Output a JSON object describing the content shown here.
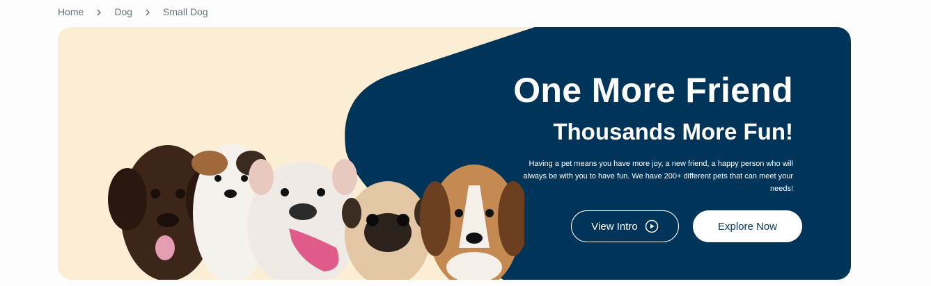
{
  "breadcrumb": {
    "items": [
      "Home",
      "Dog",
      "Small Dog"
    ],
    "separator_icon": "chevron-right-icon"
  },
  "hero": {
    "headline": "One More Friend",
    "subheadline": "Thousands More Fun!",
    "description": "Having a pet means you have more joy, a new friend, a happy person who will always be with you to have fun. We have 200+ different pets that can meet your needs!",
    "buttons": {
      "view_intro": "View Intro",
      "explore_now": "Explore Now"
    },
    "image": "group-of-puppies-image",
    "colors": {
      "cream": "#fceed5",
      "navy": "#003459",
      "white": "#ffffff"
    }
  }
}
